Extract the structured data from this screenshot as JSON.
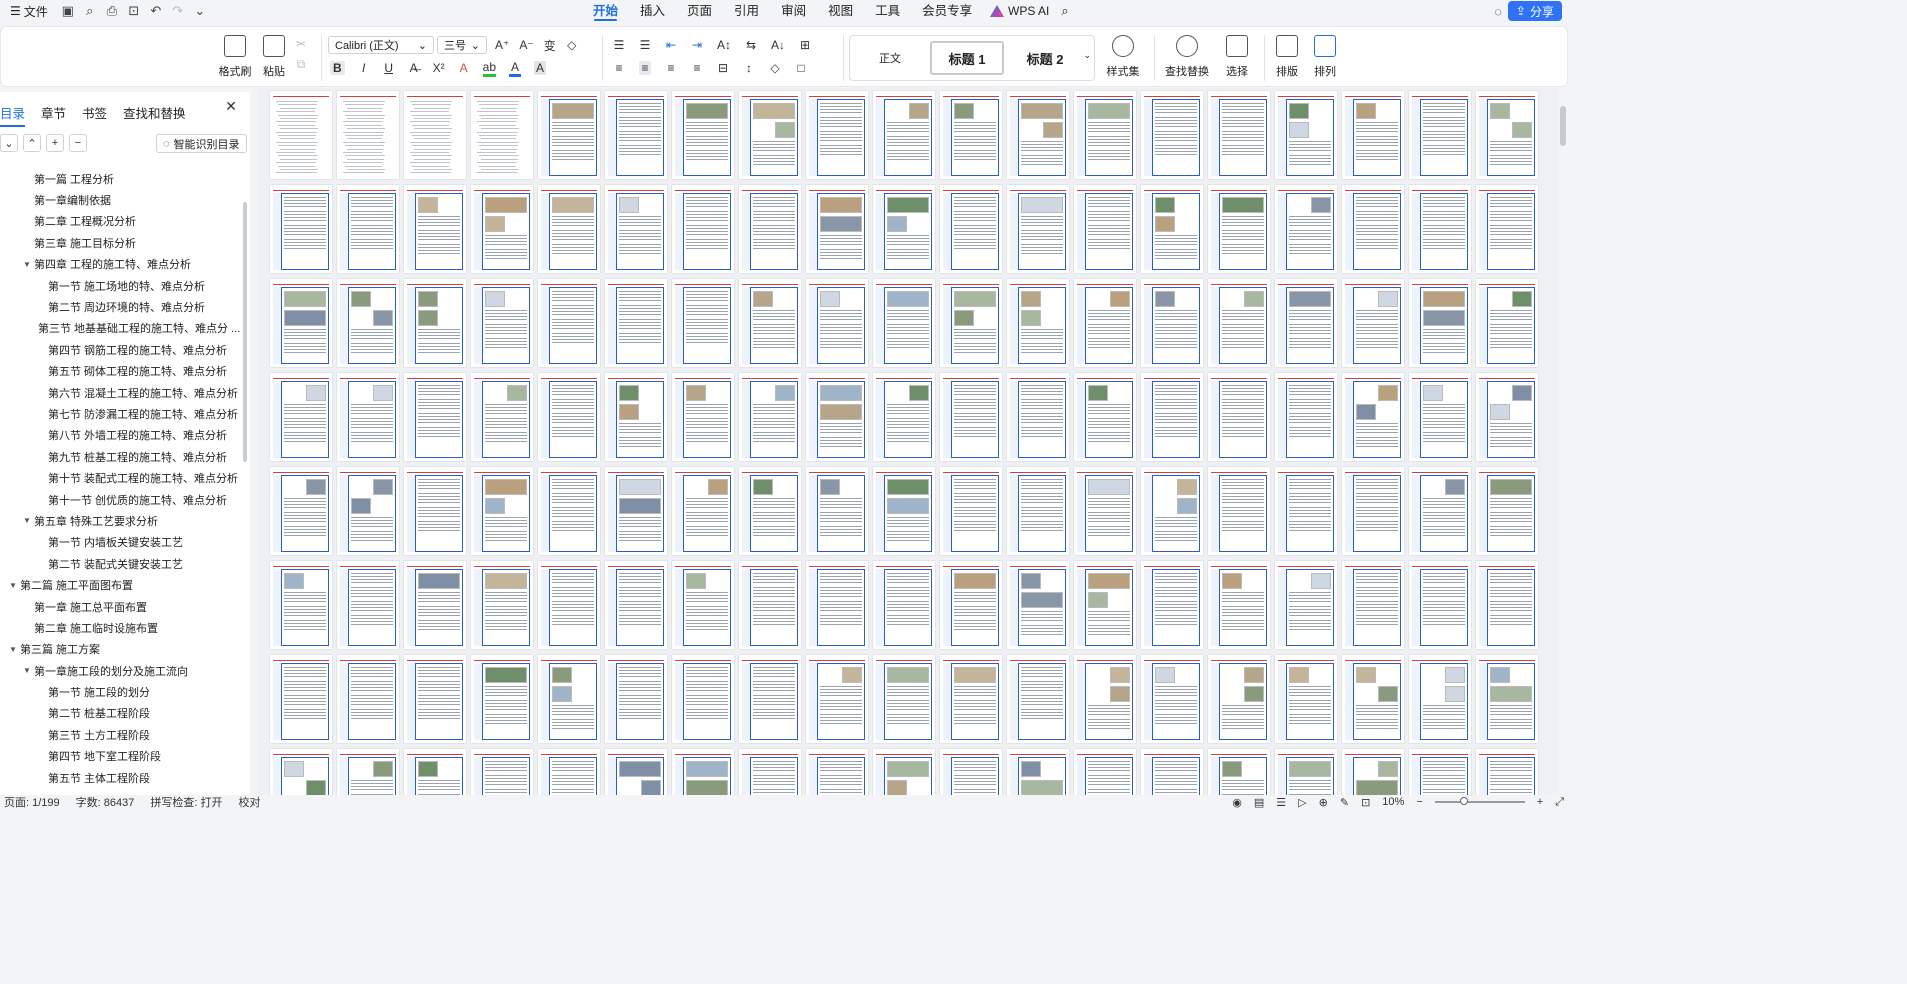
{
  "menubar": {
    "menu_icon": "hamburger-icon",
    "file_label": "文件",
    "quick_access": [
      "save-icon",
      "save-as-icon",
      "print-icon",
      "print-preview-icon",
      "undo-icon",
      "redo-icon",
      "more-icon"
    ],
    "tabs": [
      "开始",
      "插入",
      "页面",
      "引用",
      "审阅",
      "视图",
      "工具",
      "会员专享"
    ],
    "active_tab": "开始",
    "wps_ai_label": "WPS AI",
    "share_label": "分享"
  },
  "ribbon": {
    "format_painter": "格式刷",
    "paste": "粘贴",
    "font_name": "Calibri (正文)",
    "font_size": "三号",
    "styles": {
      "normal": "正文",
      "heading1": "标题  1",
      "heading2": "标题  2"
    },
    "style_set": "样式集",
    "find_replace": "查找替换",
    "select": "选择",
    "layout": "排版",
    "arrange": "排列",
    "row1_icons": [
      "A⁺",
      "A⁻",
      "变",
      "◇"
    ],
    "row2_icons": [
      "B",
      "I",
      "U",
      "A̶",
      "X²",
      "A",
      "ab",
      "A",
      "A"
    ],
    "para_row1": [
      "☰",
      "☰",
      "⇤",
      "⇥",
      "A↕",
      "⇆",
      "A↓",
      "⊞"
    ],
    "para_row2": [
      "≡",
      "≡",
      "≡",
      "≡",
      "⊟",
      "↕",
      "◇",
      "□"
    ]
  },
  "navpane": {
    "tabs": [
      "目录",
      "章节",
      "书签",
      "查找和替换"
    ],
    "active_tab": "目录",
    "smart_toc_label": "智能识别目录",
    "toc": [
      {
        "level": 1,
        "arrow": "",
        "text": "第一篇  工程分析"
      },
      {
        "level": 1,
        "arrow": "",
        "text": "第一章编制依据"
      },
      {
        "level": 1,
        "arrow": "",
        "text": "第二章  工程概况分析"
      },
      {
        "level": 1,
        "arrow": "",
        "text": "第三章  施工目标分析"
      },
      {
        "level": 1,
        "arrow": "▼",
        "text": "第四章  工程的施工特、难点分析"
      },
      {
        "level": 2,
        "arrow": "",
        "text": "第一节  施工场地的特、难点分析"
      },
      {
        "level": 2,
        "arrow": "",
        "text": "第二节  周边环境的特、难点分析"
      },
      {
        "level": 2,
        "arrow": "",
        "text": "第三节  地基基础工程的施工特、难点分 ..."
      },
      {
        "level": 2,
        "arrow": "",
        "text": "第四节  钢筋工程的施工特、难点分析"
      },
      {
        "level": 2,
        "arrow": "",
        "text": "第五节  砌体工程的施工特、难点分析"
      },
      {
        "level": 2,
        "arrow": "",
        "text": "第六节  混凝土工程的施工特、难点分析"
      },
      {
        "level": 2,
        "arrow": "",
        "text": "第七节  防渗漏工程的施工特、难点分析"
      },
      {
        "level": 2,
        "arrow": "",
        "text": "第八节  外墙工程的施工特、难点分析"
      },
      {
        "level": 2,
        "arrow": "",
        "text": "第九节  桩基工程的施工特、难点分析"
      },
      {
        "level": 2,
        "arrow": "",
        "text": "第十节  装配式工程的施工特、难点分析"
      },
      {
        "level": 2,
        "arrow": "",
        "text": "第十一节  创优质的施工特、难点分析"
      },
      {
        "level": 1,
        "arrow": "▼",
        "text": "第五章  特殊工艺要求分析"
      },
      {
        "level": 2,
        "arrow": "",
        "text": "第一节    内墙板关键安装工艺"
      },
      {
        "level": 2,
        "arrow": "",
        "text": "第二节  装配式关键安装工艺"
      },
      {
        "level": 0,
        "arrow": "▼",
        "text": "第二篇  施工平面图布置"
      },
      {
        "level": 1,
        "arrow": "",
        "text": "第一章  施工总平面布置"
      },
      {
        "level": 1,
        "arrow": "",
        "text": "第二章  施工临时设施布置"
      },
      {
        "level": 0,
        "arrow": "▼",
        "text": "第三篇  施工方案"
      },
      {
        "level": 1,
        "arrow": "▼",
        "text": "第一章施工段的划分及施工流向"
      },
      {
        "level": 2,
        "arrow": "",
        "text": "第一节  施工段的划分"
      },
      {
        "level": 2,
        "arrow": "",
        "text": "第二节  桩基工程阶段"
      },
      {
        "level": 2,
        "arrow": "",
        "text": "第三节  土方工程阶段"
      },
      {
        "level": 2,
        "arrow": "",
        "text": "第四节  地下室工程阶段"
      },
      {
        "level": 2,
        "arrow": "",
        "text": "第五节  主体工程阶段"
      }
    ]
  },
  "statusbar": {
    "page": "页面: 1/199",
    "word_count": "字数: 86437",
    "spell_check": "拼写检查: 打开",
    "proofread": "校对",
    "zoom": "10%"
  },
  "colors": {
    "accent": "#1f6fe0",
    "share_bg": "#2f72f5",
    "page_frame": "#2b5fbf",
    "header_line": "#d04040"
  }
}
